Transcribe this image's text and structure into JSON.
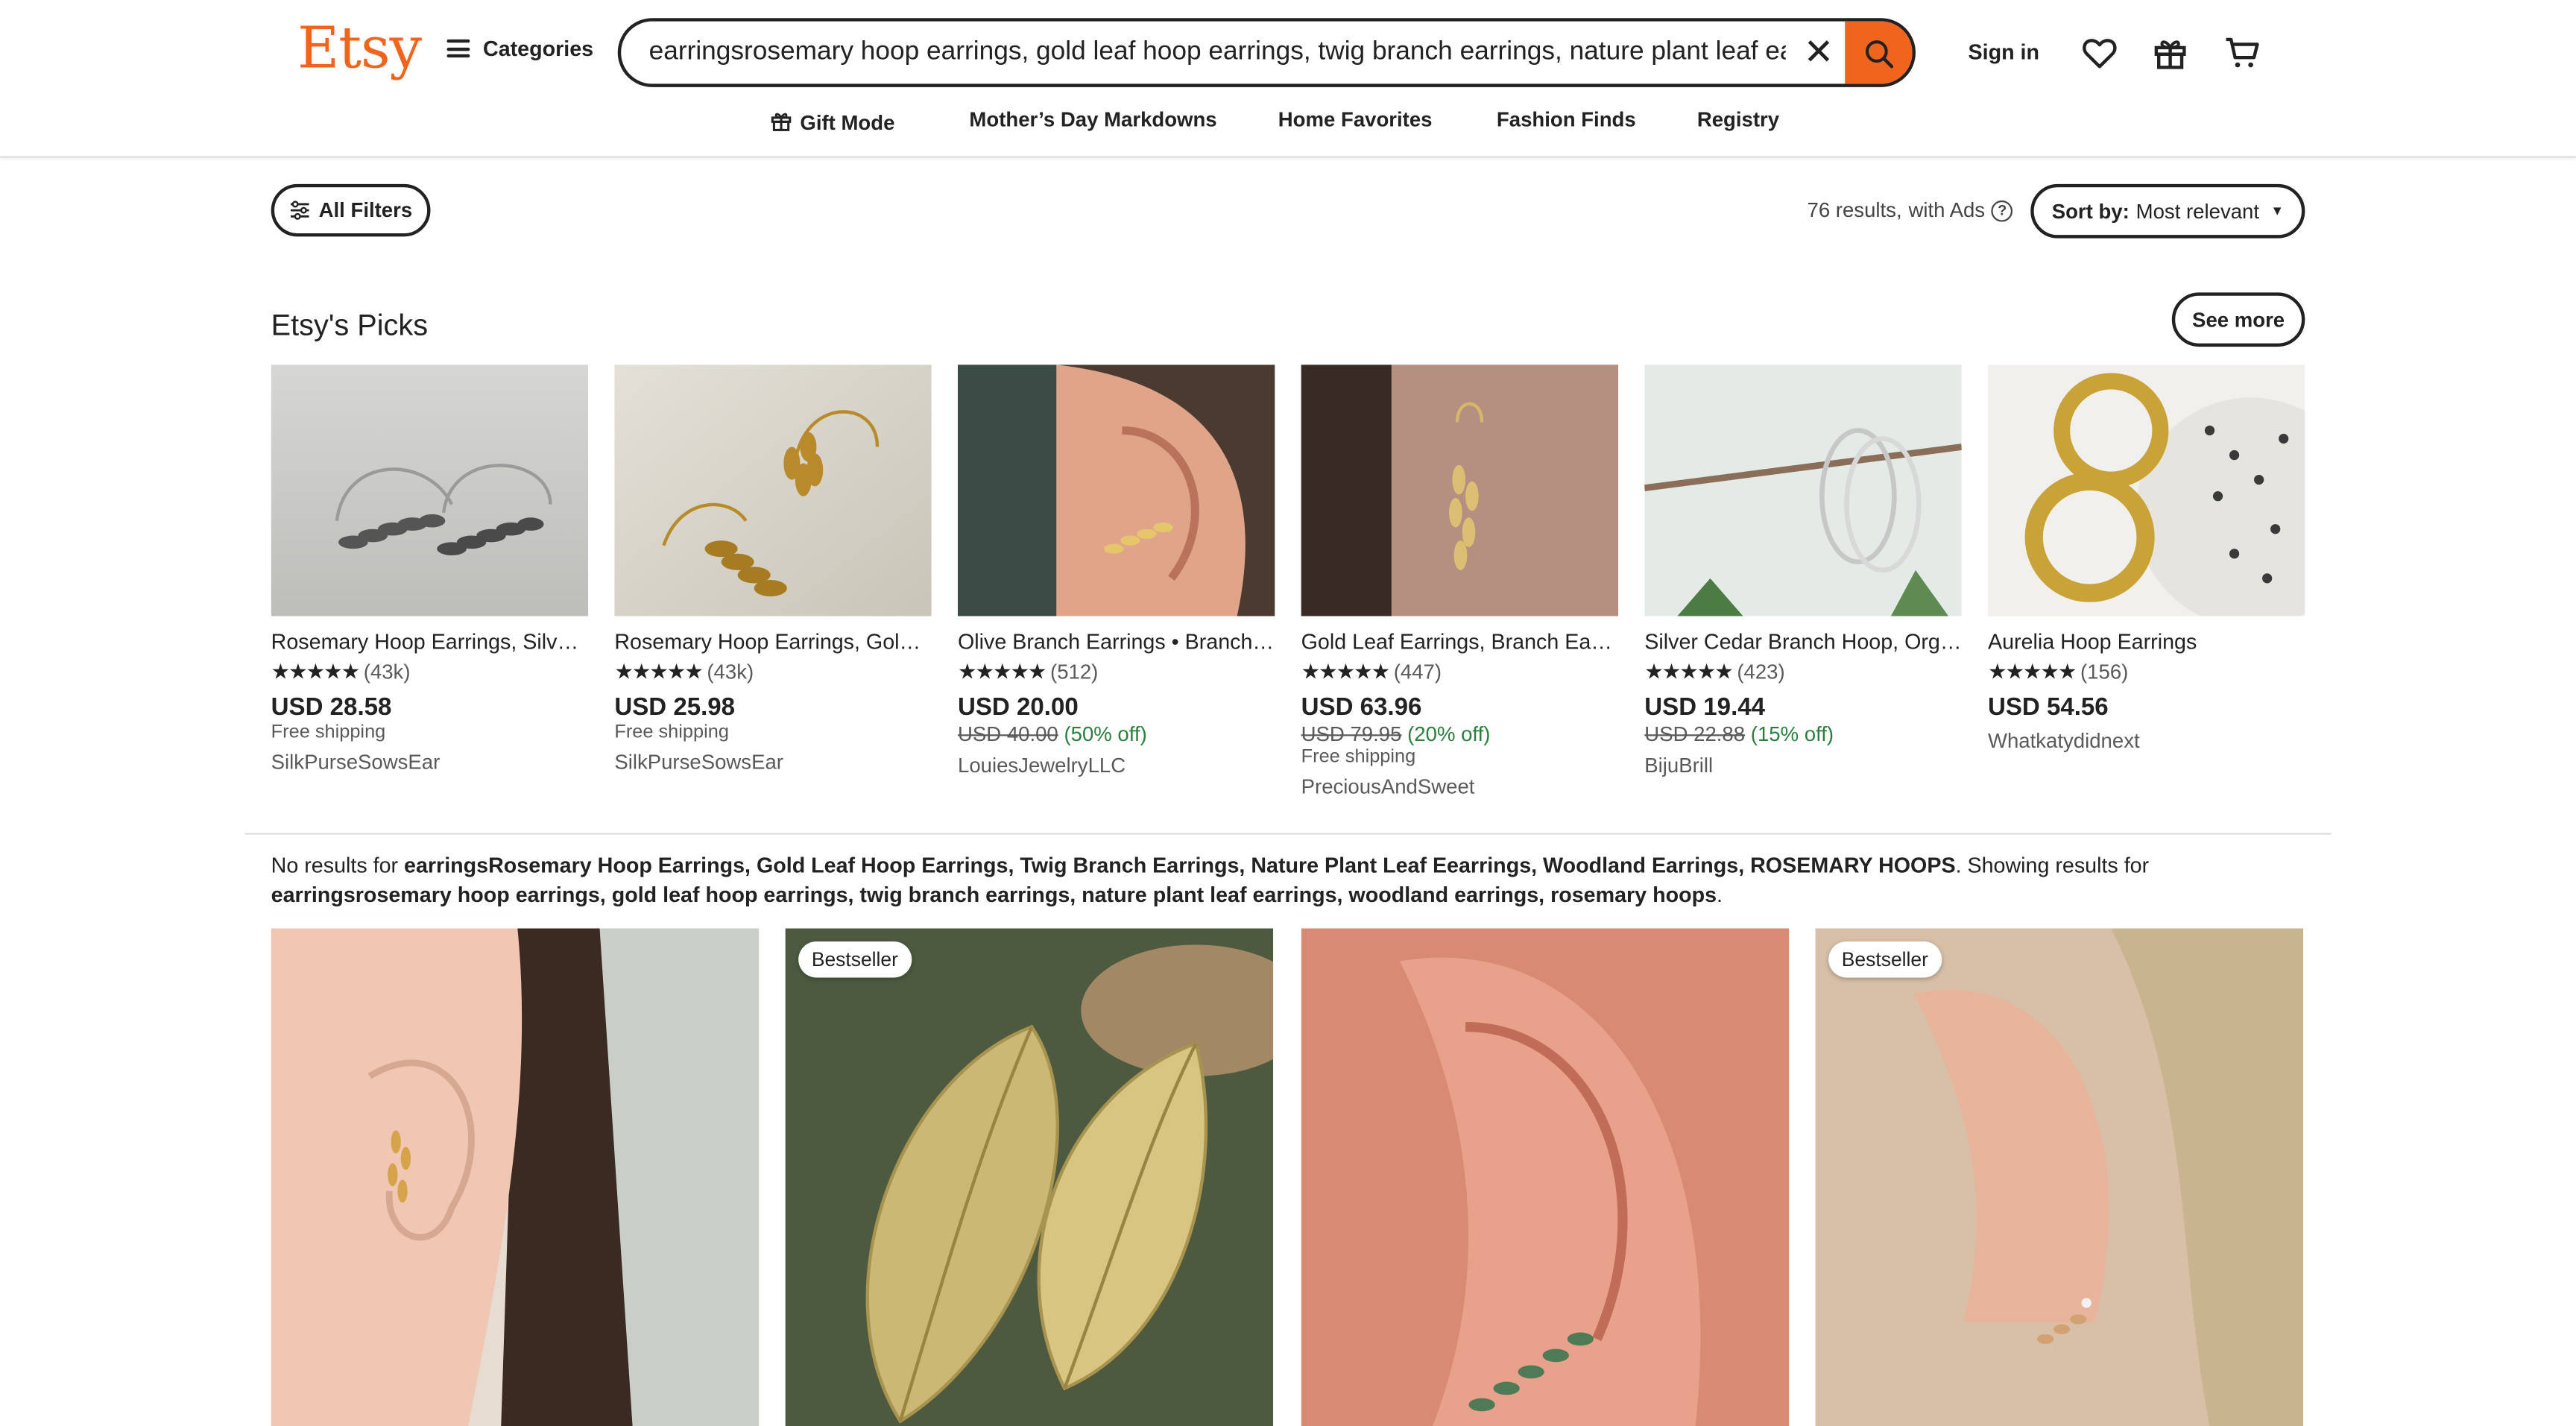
{
  "logo": "Etsy",
  "header": {
    "categories": "Categories",
    "search_value": "earringsrosemary hoop earrings, gold leaf hoop earrings, twig branch earrings, nature plant leaf ear",
    "sign_in": "Sign in"
  },
  "subnav": {
    "gift_mode": "Gift Mode",
    "mothers_day": "Mother’s Day Markdowns",
    "home_favorites": "Home Favorites",
    "fashion_finds": "Fashion Finds",
    "registry": "Registry"
  },
  "toolbar": {
    "all_filters": "All Filters",
    "results": "76 results,",
    "with_ads": "with Ads",
    "sort_label": "Sort by:",
    "sort_value": "Most relevant"
  },
  "picks": {
    "title": "Etsy's Picks",
    "see_more": "See more",
    "items": [
      {
        "title": "Rosemary Hoop Earrings, Silver Leaf Hoop",
        "reviews": "(43k)",
        "price": "USD 28.58",
        "shipping": "Free shipping",
        "shop": "SilkPurseSowsEar"
      },
      {
        "title": "Rosemary Hoop Earrings, Gold Leaf Hoop",
        "reviews": "(43k)",
        "price": "USD 25.98",
        "shipping": "Free shipping",
        "shop": "SilkPurseSowsEar"
      },
      {
        "title": "Olive Branch Earrings • Branch Ear Climber",
        "reviews": "(512)",
        "price": "USD 20.00",
        "original": "USD 40.00",
        "discount": "(50% off)",
        "shop": "LouiesJewelryLLC"
      },
      {
        "title": "Gold Leaf Earrings, Branch Earrings",
        "reviews": "(447)",
        "price": "USD 63.96",
        "original": "USD 79.95",
        "discount": "(20% off)",
        "shipping": "Free shipping",
        "shop": "PreciousAndSweet"
      },
      {
        "title": "Silver Cedar Branch Hoop, Organic Hoops",
        "reviews": "(423)",
        "price": "USD 19.44",
        "original": "USD 22.88",
        "discount": "(15% off)",
        "shop": "BijuBrill"
      },
      {
        "title": "Aurelia Hoop Earrings",
        "reviews": "(156)",
        "price": "USD 54.56",
        "shop": "Whatkatydidnext"
      }
    ]
  },
  "notice": {
    "prefix": "No results for ",
    "query": "earringsRosemary Hoop Earrings, Gold Leaf Hoop Earrings, Twig Branch Earrings, Nature Plant Leaf Eearrings, Woodland Earrings, ROSEMARY HOOPS",
    "middle": ". Showing results for ",
    "corrected": "earringsrosemary hoop earrings, gold leaf hoop earrings, twig branch earrings, nature plant leaf earrings, woodland earrings, rosemary hoops",
    "suffix": "."
  },
  "badges": {
    "bestseller": "Bestseller"
  },
  "colors": {
    "brand": "#f1641e",
    "sale": "#2a7f3e"
  }
}
